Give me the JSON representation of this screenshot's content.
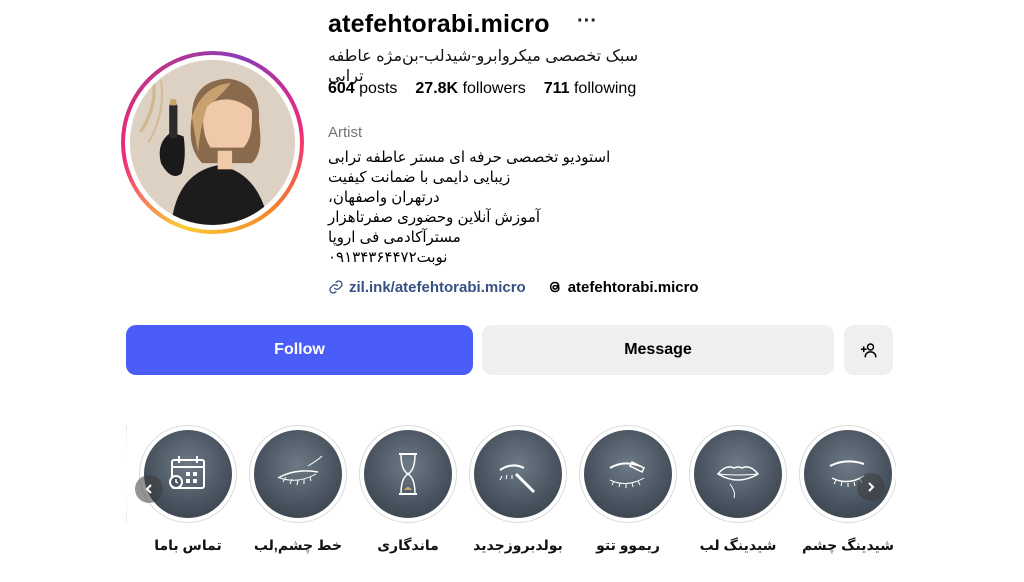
{
  "profile": {
    "username": "atefehtorabi.micro",
    "more_label": "···",
    "subtitle": "سبک تخصصی میکروابرو-شیدلب-بن‌مژه عاطفه ترابی",
    "stats": {
      "posts_count": "604",
      "posts_label": "posts",
      "followers_count": "27.8K",
      "followers_label": "followers",
      "following_count": "711",
      "following_label": "following"
    },
    "category": "Artist",
    "bio_lines": [
      "استودیو تخصصی حرفه ای مستر عاطفه ترابی",
      "زیبایی دایمی با ضمانت کیفیت",
      "درتهران واصفهان،",
      "آموزش آنلاین وحضوری صفرتاهزار",
      "مستر‌آکادمی فی اروپا",
      "نوبت۰۹۱۳۴۳۶۴۴۷۲"
    ],
    "website_link": "zil.ink/atefehtorabi.micro",
    "threads_handle": "atefehtorabi.micro"
  },
  "actions": {
    "follow_label": "Follow",
    "message_label": "Message"
  },
  "highlights": [
    {
      "label": "تماس باما",
      "icon": "calendar-icon"
    },
    {
      "label": "خط چشم,لب",
      "icon": "eyeliner-icon"
    },
    {
      "label": "ماندگاری",
      "icon": "hourglass-icon"
    },
    {
      "label": "بولدبروزجدید",
      "icon": "brow-tool-icon"
    },
    {
      "label": "ریموو تتو",
      "icon": "brow-remove-icon"
    },
    {
      "label": "شیدینگ لب",
      "icon": "lips-icon"
    },
    {
      "label": "شیدینگ چشم",
      "icon": "eye-icon"
    }
  ],
  "colors": {
    "follow_bg": "#4a5df9",
    "link": "#385185",
    "muted": "#737373",
    "button_bg": "#efefef"
  }
}
